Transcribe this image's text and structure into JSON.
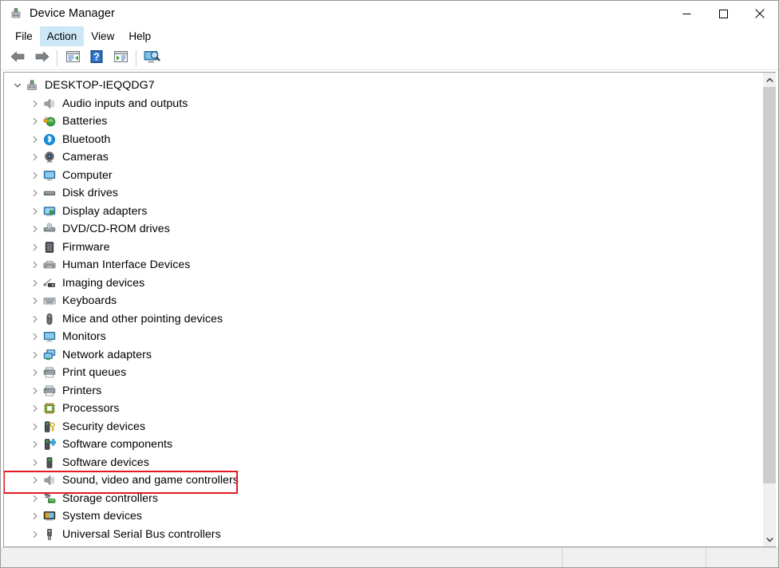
{
  "window": {
    "title": "Device Manager",
    "icon": "device-manager-icon",
    "controls": {
      "minimize": "minimize-icon",
      "maximize": "maximize-icon",
      "close": "close-icon"
    }
  },
  "menubar": {
    "items": [
      {
        "label": "File",
        "active": false
      },
      {
        "label": "Action",
        "active": true
      },
      {
        "label": "View",
        "active": false
      },
      {
        "label": "Help",
        "active": false
      }
    ]
  },
  "toolbar": {
    "buttons": [
      {
        "name": "back-arrow-icon",
        "type": "back"
      },
      {
        "name": "forward-arrow-icon",
        "type": "forward"
      },
      {
        "name": "separator-1",
        "type": "separator"
      },
      {
        "name": "properties-icon",
        "type": "properties"
      },
      {
        "name": "help-icon",
        "type": "help"
      },
      {
        "name": "update-driver-icon",
        "type": "update"
      },
      {
        "name": "separator-2",
        "type": "separator"
      },
      {
        "name": "scan-hardware-changes-icon",
        "type": "scan"
      }
    ]
  },
  "tree": {
    "root": {
      "label": "DESKTOP-IEQQDG7",
      "expanded": true,
      "icon": "computer-root-icon"
    },
    "items": [
      {
        "label": "Audio inputs and outputs",
        "icon": "speaker-icon",
        "expanded": false,
        "highlighted": false
      },
      {
        "label": "Batteries",
        "icon": "battery-icon",
        "expanded": false,
        "highlighted": false
      },
      {
        "label": "Bluetooth",
        "icon": "bluetooth-icon",
        "expanded": false,
        "highlighted": false
      },
      {
        "label": "Cameras",
        "icon": "camera-icon",
        "expanded": false,
        "highlighted": false
      },
      {
        "label": "Computer",
        "icon": "monitor-icon",
        "expanded": false,
        "highlighted": false
      },
      {
        "label": "Disk drives",
        "icon": "disk-drive-icon",
        "expanded": false,
        "highlighted": false
      },
      {
        "label": "Display adapters",
        "icon": "display-adapter-icon",
        "expanded": false,
        "highlighted": false
      },
      {
        "label": "DVD/CD-ROM drives",
        "icon": "dvd-drive-icon",
        "expanded": false,
        "highlighted": false
      },
      {
        "label": "Firmware",
        "icon": "firmware-icon",
        "expanded": false,
        "highlighted": false
      },
      {
        "label": "Human Interface Devices",
        "icon": "hid-icon",
        "expanded": false,
        "highlighted": false
      },
      {
        "label": "Imaging devices",
        "icon": "imaging-icon",
        "expanded": false,
        "highlighted": false
      },
      {
        "label": "Keyboards",
        "icon": "keyboard-icon",
        "expanded": false,
        "highlighted": false
      },
      {
        "label": "Mice and other pointing devices",
        "icon": "mouse-icon",
        "expanded": false,
        "highlighted": false
      },
      {
        "label": "Monitors",
        "icon": "monitor-icon",
        "expanded": false,
        "highlighted": false
      },
      {
        "label": "Network adapters",
        "icon": "network-adapter-icon",
        "expanded": false,
        "highlighted": false
      },
      {
        "label": "Print queues",
        "icon": "printer-icon",
        "expanded": false,
        "highlighted": false
      },
      {
        "label": "Printers",
        "icon": "printer-icon",
        "expanded": false,
        "highlighted": false
      },
      {
        "label": "Processors",
        "icon": "processor-icon",
        "expanded": false,
        "highlighted": false
      },
      {
        "label": "Security devices",
        "icon": "security-device-icon",
        "expanded": false,
        "highlighted": false
      },
      {
        "label": "Software components",
        "icon": "software-component-icon",
        "expanded": false,
        "highlighted": false
      },
      {
        "label": "Software devices",
        "icon": "software-device-icon",
        "expanded": false,
        "highlighted": false
      },
      {
        "label": "Sound, video and game controllers",
        "icon": "speaker-icon",
        "expanded": false,
        "highlighted": true
      },
      {
        "label": "Storage controllers",
        "icon": "storage-controller-icon",
        "expanded": false,
        "highlighted": false
      },
      {
        "label": "System devices",
        "icon": "system-device-icon",
        "expanded": false,
        "highlighted": false
      },
      {
        "label": "Universal Serial Bus controllers",
        "icon": "usb-icon",
        "expanded": false,
        "highlighted": false
      }
    ]
  },
  "statusbar": {
    "pane1": "",
    "pane2": "",
    "pane3": ""
  },
  "colors": {
    "highlight_rect": "#e01b22",
    "menu_active": "#cce8f6",
    "accent_blue": "#0078d7"
  }
}
